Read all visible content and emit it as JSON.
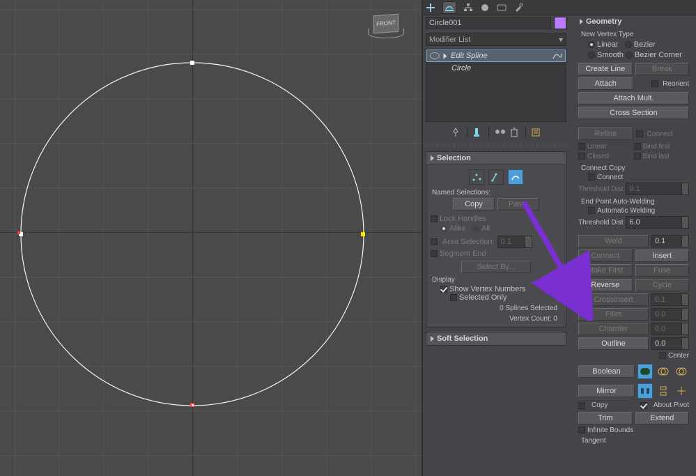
{
  "viewport": {
    "cube_label": "FRONT"
  },
  "object_name": "Circle001",
  "modifier_placeholder": "Modifier List",
  "stack": {
    "active": "Edit Spline",
    "base": "Circle"
  },
  "selection": {
    "title": "Selection",
    "named_label": "Named Selections:",
    "copy": "Copy",
    "paste": "Paste",
    "lock_handles": "Lock Handles",
    "alike": "Alike",
    "all": "All",
    "area_selection": "Area Selection:",
    "area_value": "0.1",
    "segment_end": "Segment End",
    "select_by": "Select By...",
    "display_label": "Display",
    "show_vn": "Show Vertex Numbers",
    "selected_only": "Selected Only",
    "status1": "0 Splines Selected",
    "status2": "Vertex Count: 0"
  },
  "soft_selection": {
    "title": "Soft Selection"
  },
  "geometry": {
    "title": "Geometry",
    "new_vertex_type": "New Vertex Type",
    "vt_linear": "Linear",
    "vt_bezier": "Bezier",
    "vt_smooth": "Smooth",
    "vt_bc": "Bezier Corner",
    "create_line": "Create Line",
    "break": "Break",
    "attach": "Attach",
    "reorient": "Reorient",
    "attach_mult": "Attach Mult.",
    "cross_section": "Cross Section",
    "refine": "Refine",
    "connect": "Connect",
    "linear": "Linear",
    "bind_first": "Bind first",
    "closed": "Closed",
    "bind_last": "Bind last",
    "connect_copy": "Connect Copy",
    "cc_connect": "Connect",
    "threshold_dist": "Threshold Dist",
    "cc_val": "0.1",
    "end_point": "End Point Auto-Welding",
    "auto_weld": "Automatic Welding",
    "aw_val": "6.0",
    "weld": "Weld",
    "weld_val": "0.1",
    "connect_btn": "Connect",
    "insert": "Insert",
    "make_first": "Make First",
    "fuse": "Fuse",
    "reverse": "Reverse",
    "cycle": "Cycle",
    "cross_insert": "CrossInsert",
    "ci_val": "0.1",
    "fillet": "Fillet",
    "fillet_val": "0.0",
    "chamfer": "Chamfer",
    "chamfer_val": "0.0",
    "outline": "Outline",
    "outline_val": "0.0",
    "center": "Center",
    "boolean": "Boolean",
    "mirror": "Mirror",
    "copy": "Copy",
    "about_pivot": "About Pivot",
    "trim": "Trim",
    "extend": "Extend",
    "infinite_bounds": "Infinite Bounds",
    "tangent": "Tangent"
  }
}
